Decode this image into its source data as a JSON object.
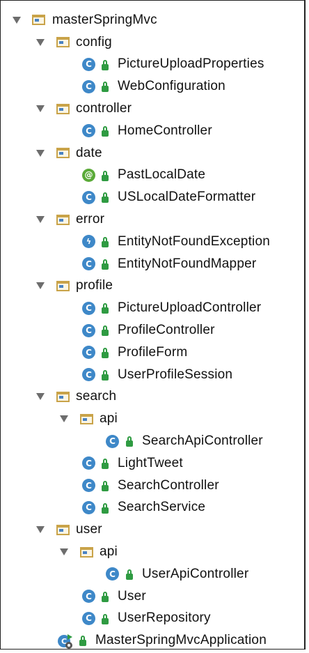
{
  "project_tree": {
    "root": "masterSpringMvc",
    "packages": {
      "config": {
        "label": "config",
        "classes": [
          "PictureUploadProperties",
          "WebConfiguration"
        ]
      },
      "controller": {
        "label": "controller",
        "classes": [
          "HomeController"
        ]
      },
      "date": {
        "label": "date",
        "classes": [
          "PastLocalDate",
          "USLocalDateFormatter"
        ]
      },
      "error": {
        "label": "error",
        "classes": [
          "EntityNotFoundException",
          "EntityNotFoundMapper"
        ]
      },
      "profile": {
        "label": "profile",
        "classes": [
          "PictureUploadController",
          "ProfileController",
          "ProfileForm",
          "UserProfileSession"
        ]
      },
      "search": {
        "label": "search",
        "api_label": "api",
        "api_classes": [
          "SearchApiController"
        ],
        "classes": [
          "LightTweet",
          "SearchController",
          "SearchService"
        ]
      },
      "user": {
        "label": "user",
        "api_label": "api",
        "api_classes": [
          "UserApiController"
        ],
        "classes": [
          "User",
          "UserRepository"
        ]
      }
    },
    "application_class": "MasterSpringMvcApplication"
  },
  "icons": {
    "class_letter": "C",
    "annotation_letter": "@",
    "exception_letter": "ϟ"
  },
  "colors": {
    "class_icon": "#3e88c8",
    "annotation_icon": "#5aaa38",
    "lock_icon": "#2f9b42",
    "folder_border": "#c9a349"
  }
}
